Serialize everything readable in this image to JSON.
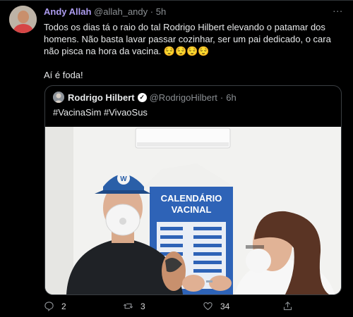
{
  "tweet": {
    "author_name": "Andy Allah",
    "author_handle": "@allah_andy",
    "separator": "·",
    "time": "5h",
    "more": "...",
    "lines": [
      "Todos os dias tá o raio do tal Rodrigo Hilbert elevando o patamar dos homens. Não basta lavar passar cozinhar, ser um pai dedicado, o cara não pisca na hora da vacina. 😌😌😌😌"
    ],
    "closing": "Aí é foda!"
  },
  "quoted": {
    "author_name": "Rodrigo Hilbert",
    "verified_mark": "✓",
    "author_handle": "@RodrigoHilbert",
    "separator": "·",
    "time": "6h",
    "text": "#VacinaSim #VivaoSus",
    "poster_title_1": "CALENDÁRIO",
    "poster_title_2": "VACINAL"
  },
  "actions": {
    "reply_count": "2",
    "retweet_count": "3",
    "like_count": "34"
  }
}
